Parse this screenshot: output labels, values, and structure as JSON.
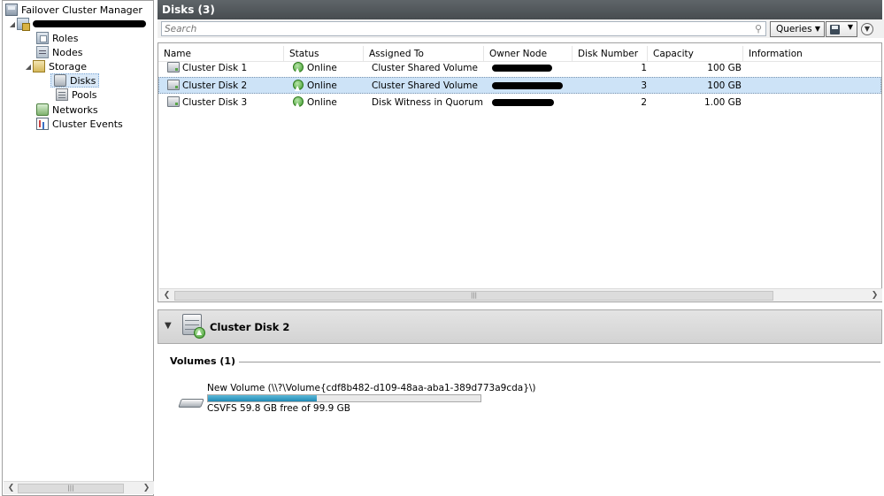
{
  "tree": {
    "root_label": "Failover Cluster Manager",
    "items": [
      {
        "label": "Roles"
      },
      {
        "label": "Nodes"
      },
      {
        "label": "Storage"
      },
      {
        "label": "Disks"
      },
      {
        "label": "Pools"
      },
      {
        "label": "Networks"
      },
      {
        "label": "Cluster Events"
      }
    ]
  },
  "header": {
    "title": "Disks (3)"
  },
  "search": {
    "placeholder": "Search",
    "queries_label": "Queries"
  },
  "table": {
    "columns": [
      "Name",
      "Status",
      "Assigned To",
      "Owner Node",
      "Disk Number",
      "Capacity",
      "Information"
    ],
    "rows": [
      {
        "name": "Cluster Disk 1",
        "status": "Online",
        "assigned_to": "Cluster Shared Volume",
        "disk_number": "1",
        "capacity": "100 GB",
        "information": ""
      },
      {
        "name": "Cluster Disk 2",
        "status": "Online",
        "assigned_to": "Cluster Shared Volume",
        "disk_number": "3",
        "capacity": "100 GB",
        "information": ""
      },
      {
        "name": "Cluster Disk 3",
        "status": "Online",
        "assigned_to": "Disk Witness in Quorum",
        "disk_number": "2",
        "capacity": "1.00 GB",
        "information": ""
      }
    ],
    "selected_row": 1
  },
  "detail": {
    "title": "Cluster Disk 2",
    "volumes_title": "Volumes (1)",
    "volume": {
      "name": "New Volume (\\\\?\\Volume{cdf8b482-d109-48aa-aba1-389d773a9cda}\\)",
      "free_text": "CSVFS 59.8 GB free of 99.9 GB",
      "used_fraction": 0.4
    }
  },
  "icons": {
    "root": "failover-cluster-manager-icon",
    "cluster": "cluster-icon",
    "roles": "roles-icon",
    "nodes": "nodes-icon",
    "storage": "storage-folder-icon",
    "disks": "disks-icon",
    "pools": "pools-icon",
    "networks": "networks-icon",
    "events": "cluster-events-icon",
    "status_online": "online-status-icon"
  }
}
